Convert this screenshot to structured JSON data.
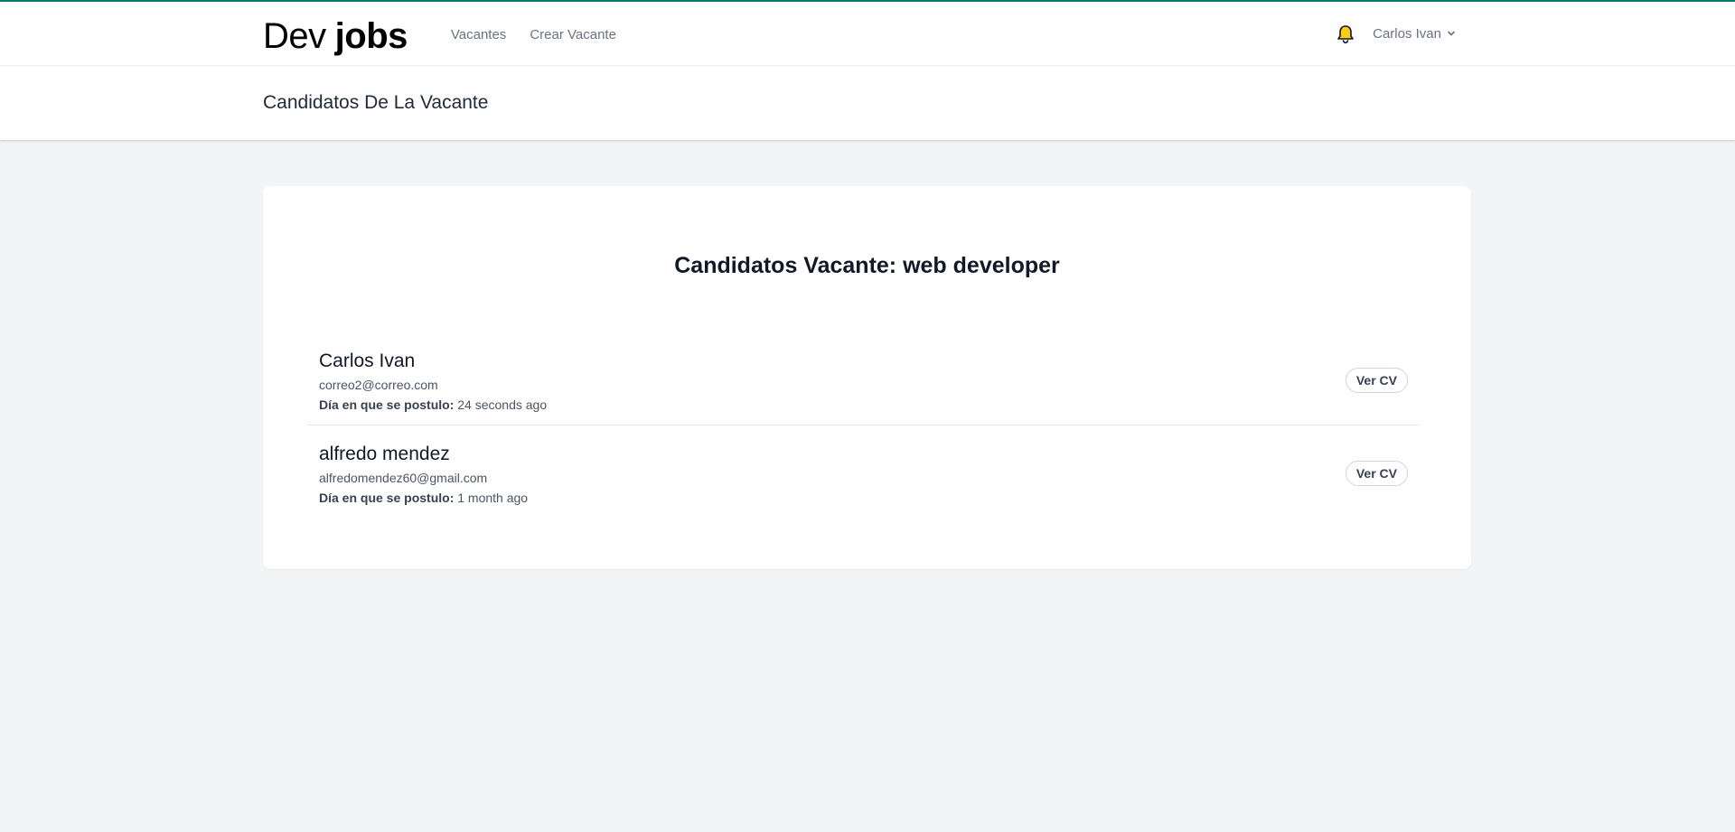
{
  "brand": {
    "light": "Dev",
    "bold": "jobs"
  },
  "nav": {
    "links": [
      "Vacantes",
      "Crear Vacante"
    ],
    "user_name": "Carlos Ivan"
  },
  "header": {
    "title": "Candidatos De La Vacante"
  },
  "main": {
    "title": "Candidatos Vacante: web developer",
    "date_label": "Día en que se postulo:",
    "cv_button_label": "Ver CV",
    "candidates": [
      {
        "name": "Carlos Ivan",
        "email": "correo2@correo.com",
        "applied": "24 seconds ago"
      },
      {
        "name": "alfredo mendez",
        "email": "alfredomendez60@gmail.com",
        "applied": "1 month ago"
      }
    ]
  },
  "icons": {
    "notifications": "bell-icon",
    "user_menu": "chevron-down-icon"
  },
  "colors": {
    "accent": "#0f766e",
    "bell": "#facc15",
    "background": "#f3f4f6"
  }
}
